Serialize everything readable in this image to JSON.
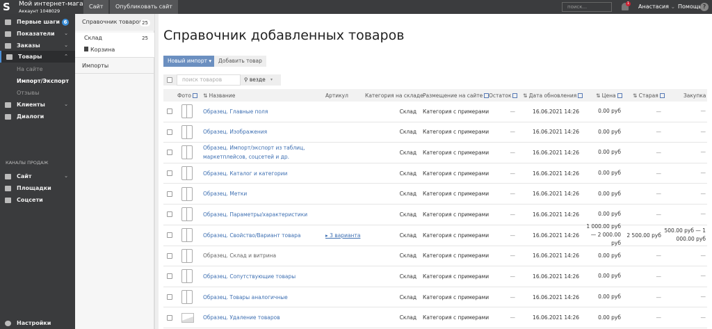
{
  "topbar": {
    "shop_name": "Мой интернет-магазин",
    "account": "Аккаунт 1048029",
    "site_btn": "Сайт",
    "publish_btn": "Опубликовать сайт",
    "search_placeholder": "поиск...",
    "notif_count": "1",
    "user": "Анастасия",
    "help": "Помощь",
    "help_icon": "?",
    "logo": "S"
  },
  "sidebar": {
    "items": [
      {
        "label": "Первые шаги",
        "badge": "6"
      },
      {
        "label": "Показатели"
      },
      {
        "label": "Заказы"
      },
      {
        "label": "Товары"
      },
      {
        "label": "Клиенты"
      },
      {
        "label": "Диалоги"
      }
    ],
    "sub": [
      "На сайте",
      "Импорт/Экспорт",
      "Отзывы"
    ],
    "channels_title": "КАНАЛЫ ПРОДАЖ",
    "channels": [
      "Сайт",
      "Площадки",
      "Соцсети"
    ],
    "settings": "Настройки"
  },
  "panel": {
    "catalog": "Справочник товаров",
    "catalog_count": "25",
    "warehouse": "Склад",
    "warehouse_count": "25",
    "trash": "Корзина",
    "imports": "Импорты"
  },
  "main": {
    "title": "Справочник добавленных товаров",
    "new_import": "Новый импорт ▾",
    "add_product": "Добавить товар",
    "search_placeholder": "поиск товаров",
    "scope": "везде",
    "scope_caret": "▾"
  },
  "table": {
    "headers": {
      "photo": "Фото",
      "name": "Название",
      "article": "Артикул",
      "category": "Категория на складе",
      "placement": "Размещение на сайте",
      "stock": "Остаток",
      "date": "Дата обновления",
      "price": "Цена",
      "old": "Старая",
      "purchase": "Закупка"
    },
    "rows": [
      {
        "name": "Образец. Главные поля",
        "article": "",
        "category": "Склад",
        "placement": "Категория с примерами",
        "stock": "—",
        "date": "16.06.2021 14:26",
        "price": "0.00 руб",
        "old": "—",
        "purchase": "—"
      },
      {
        "name": "Образец. Изображения",
        "article": "",
        "category": "Склад",
        "placement": "Категория с примерами",
        "stock": "—",
        "date": "16.06.2021 14:26",
        "price": "0.00 руб",
        "old": "—",
        "purchase": "—"
      },
      {
        "name": "Образец. Импорт/экспорт из таблиц, маркетплейсов, соцсетей и др.",
        "article": "",
        "category": "Склад",
        "placement": "Категория с примерами",
        "stock": "—",
        "date": "16.06.2021 14:26",
        "price": "0.00 руб",
        "old": "—",
        "purchase": "—"
      },
      {
        "name": "Образец. Каталог и категории",
        "article": "",
        "category": "Склад",
        "placement": "Категория с примерами",
        "stock": "—",
        "date": "16.06.2021 14:26",
        "price": "0.00 руб",
        "old": "—",
        "purchase": "—"
      },
      {
        "name": "Образец. Метки",
        "article": "",
        "category": "Склад",
        "placement": "Категория с примерами",
        "stock": "—",
        "date": "16.06.2021 14:26",
        "price": "0.00 руб",
        "old": "—",
        "purchase": "—"
      },
      {
        "name": "Образец. Параметры/характеристики",
        "article": "",
        "category": "Склад",
        "placement": "Категория с примерами",
        "stock": "—",
        "date": "16.06.2021 14:26",
        "price": "0.00 руб",
        "old": "—",
        "purchase": "—"
      },
      {
        "name": "Образец. Свойство/Вариант товара",
        "article": "▸ 3 варианта",
        "category": "Склад",
        "placement": "Категория с примерами",
        "stock": "—",
        "date": "16.06.2021 14:26",
        "price": "1 000.00 руб — 2 000.00 руб",
        "old": "2 500.00 руб",
        "purchase": "500.00 руб — 1 000.00 руб"
      },
      {
        "name": "Образец. Склад и витрина",
        "article": "",
        "category": "Склад",
        "placement": "Категория с примерами",
        "stock": "—",
        "date": "16.06.2021 14:26",
        "price": "0.00 руб",
        "old": "—",
        "purchase": "—",
        "muted": true
      },
      {
        "name": "Образец. Сопутствующие товары",
        "article": "",
        "category": "Склад",
        "placement": "Категория с примерами",
        "stock": "—",
        "date": "16.06.2021 14:26",
        "price": "0.00 руб",
        "old": "—",
        "purchase": "—"
      },
      {
        "name": "Образец. Товары аналогичные",
        "article": "",
        "category": "Склад",
        "placement": "Категория с примерами",
        "stock": "—",
        "date": "16.06.2021 14:26",
        "price": "0.00 руб",
        "old": "—",
        "purchase": "—"
      },
      {
        "name": "Образец. Удаление товаров",
        "article": "",
        "category": "Склад",
        "placement": "Категория с примерами",
        "stock": "—",
        "date": "16.06.2021 14:26",
        "price": "0.00 руб",
        "old": "—",
        "purchase": "—",
        "image": true
      }
    ]
  }
}
